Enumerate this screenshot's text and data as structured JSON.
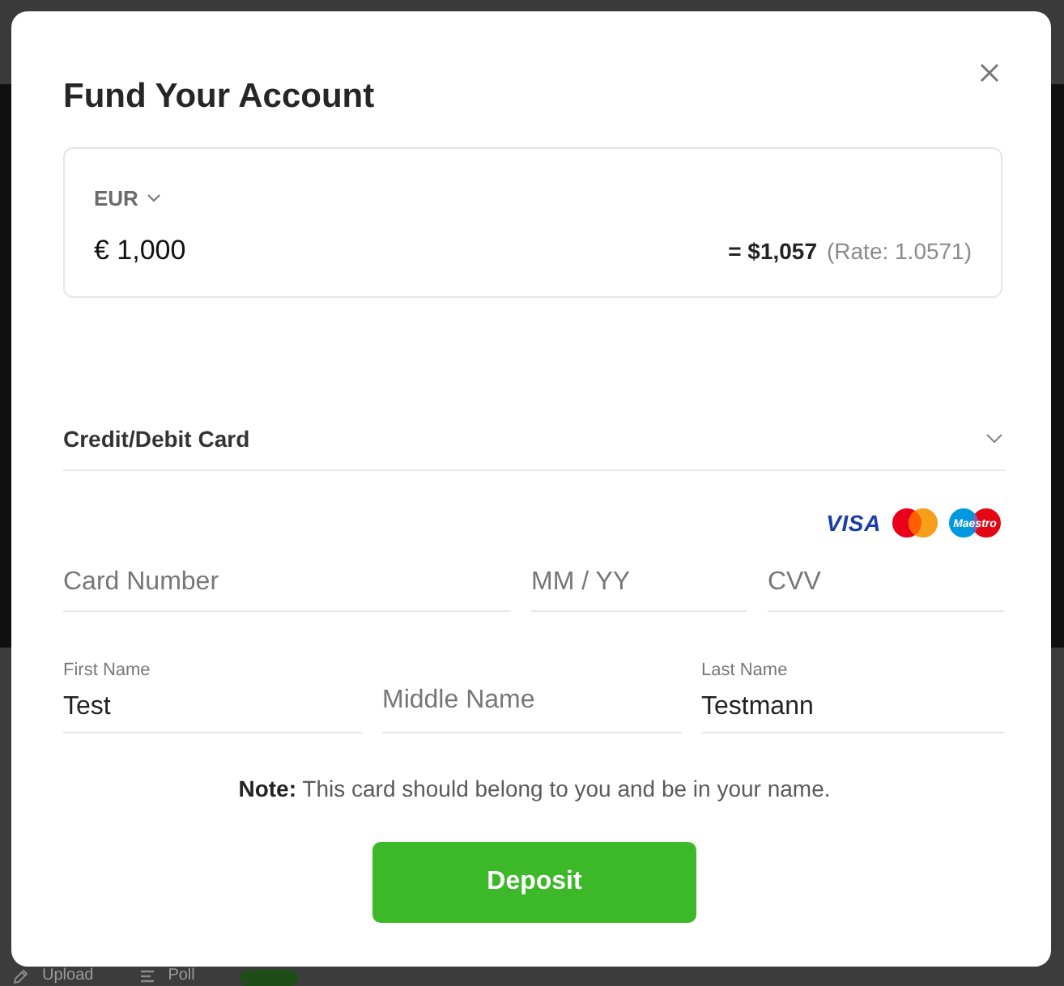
{
  "modal": {
    "title": "Fund Your Account",
    "currency": {
      "code": "EUR",
      "amount": "€ 1,000",
      "converted": "= $1,057",
      "rate": "(Rate: 1.0571)"
    },
    "payment_method": {
      "label": "Credit/Debit Card"
    },
    "card_brands": [
      {
        "kind": "visa",
        "text": "VISA"
      },
      {
        "kind": "mastercard"
      },
      {
        "kind": "maestro",
        "text": "Maestro"
      }
    ],
    "card_fields": [
      {
        "placeholder": "Card Number"
      },
      {
        "placeholder": "MM / YY"
      },
      {
        "placeholder": "CVV"
      }
    ],
    "name_fields": [
      {
        "label": "First Name",
        "value": "Test"
      },
      {
        "placeholder": "Middle Name"
      },
      {
        "label": "Last Name",
        "value": "Testmann"
      }
    ],
    "note": "**Note:** This card should belong to you and be in your name.",
    "submit_button": "Deposit"
  },
  "background_toolbar": {
    "items": [
      {
        "kind": "upload",
        "label": "Upload"
      },
      {
        "kind": "poll",
        "label": "Poll"
      }
    ]
  }
}
